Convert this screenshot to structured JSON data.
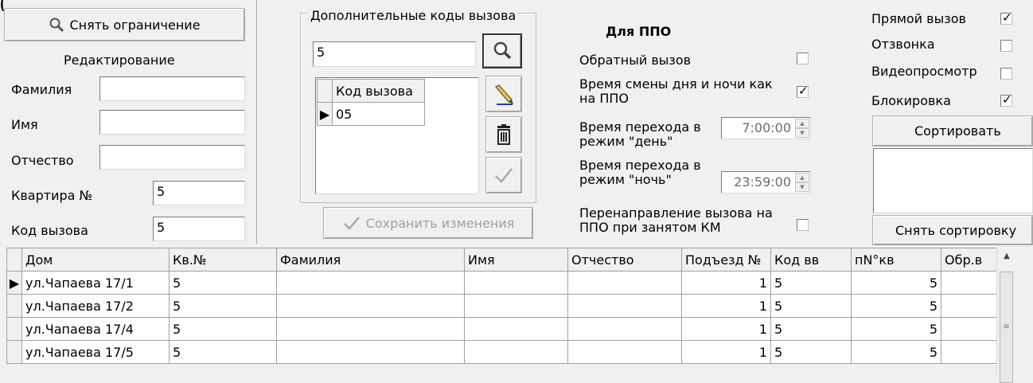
{
  "top_fragment": "(",
  "left_panel": {
    "remove_limit_button": "Снять ограничение",
    "edit_heading": "Редактирование",
    "fields": [
      {
        "label": "Фамилия",
        "value": ""
      },
      {
        "label": "Имя",
        "value": ""
      },
      {
        "label": "Отчество",
        "value": ""
      },
      {
        "label": "Квартира №",
        "value": "5"
      },
      {
        "label": "Код вызова",
        "value": "5"
      }
    ]
  },
  "codes_panel": {
    "title": "Дополнительные коды вызова",
    "code_input": "5",
    "table_header": "Код вызова",
    "rows": [
      "05"
    ],
    "save_button": "Сохранить изменения"
  },
  "ppo_panel": {
    "title": "Для ППО",
    "callback_label": "Обратный вызов",
    "callback_checked": false,
    "daynight_label": "Время смены дня и ночи как на ППО",
    "daynight_checked": true,
    "day_label": "Время перехода в режим \"день\"",
    "day_time": "7:00:00",
    "night_label": "Время перехода в режим \"ночь\"",
    "night_time": "23:59:00",
    "redirect_label": "Перенаправление вызова на ППО при занятом КМ",
    "redirect_checked": false
  },
  "right_panel": {
    "checks": [
      {
        "label": "Прямой вызов",
        "checked": true
      },
      {
        "label": "Отзвонка",
        "checked": false
      },
      {
        "label": "Видеопросмотр",
        "checked": false
      },
      {
        "label": "Блокировка",
        "checked": true
      }
    ],
    "sort_button": "Сортировать",
    "unsort_button": "Снять сортировку"
  },
  "grid": {
    "columns": [
      "Дом",
      "Кв.№",
      "Фамилия",
      "Имя",
      "Отчество",
      "Подъезд №",
      "Код вв",
      "пN°кв",
      "Обр.в"
    ],
    "rows": [
      [
        "ул.Чапаева 17/1",
        "5",
        "",
        "",
        "",
        "1",
        "5",
        "5",
        ""
      ],
      [
        "ул.Чапаева 17/2",
        "5",
        "",
        "",
        "",
        "1",
        "5",
        "5",
        ""
      ],
      [
        "ул.Чапаева 17/4",
        "5",
        "",
        "",
        "",
        "1",
        "5",
        "5",
        ""
      ],
      [
        "ул.Чапаева 17/5",
        "5",
        "",
        "",
        "",
        "1",
        "5",
        "5",
        ""
      ]
    ],
    "current_row": 0
  },
  "icons": [
    "search-icon",
    "pencil-icon",
    "trash-icon",
    "checkmark-icon",
    "row-pointer-icon",
    "scroll-up-icon"
  ]
}
